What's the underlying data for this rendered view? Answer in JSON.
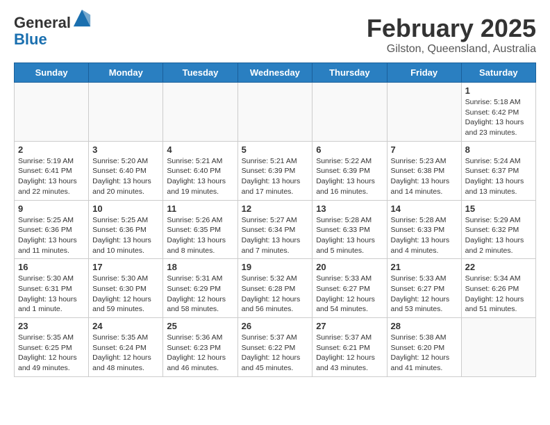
{
  "header": {
    "logo": {
      "general": "General",
      "blue": "Blue"
    },
    "title": "February 2025",
    "subtitle": "Gilston, Queensland, Australia"
  },
  "weekdays": [
    "Sunday",
    "Monday",
    "Tuesday",
    "Wednesday",
    "Thursday",
    "Friday",
    "Saturday"
  ],
  "weeks": [
    [
      {
        "day": "",
        "info": ""
      },
      {
        "day": "",
        "info": ""
      },
      {
        "day": "",
        "info": ""
      },
      {
        "day": "",
        "info": ""
      },
      {
        "day": "",
        "info": ""
      },
      {
        "day": "",
        "info": ""
      },
      {
        "day": "1",
        "info": "Sunrise: 5:18 AM\nSunset: 6:42 PM\nDaylight: 13 hours and 23 minutes."
      }
    ],
    [
      {
        "day": "2",
        "info": "Sunrise: 5:19 AM\nSunset: 6:41 PM\nDaylight: 13 hours and 22 minutes."
      },
      {
        "day": "3",
        "info": "Sunrise: 5:20 AM\nSunset: 6:40 PM\nDaylight: 13 hours and 20 minutes."
      },
      {
        "day": "4",
        "info": "Sunrise: 5:21 AM\nSunset: 6:40 PM\nDaylight: 13 hours and 19 minutes."
      },
      {
        "day": "5",
        "info": "Sunrise: 5:21 AM\nSunset: 6:39 PM\nDaylight: 13 hours and 17 minutes."
      },
      {
        "day": "6",
        "info": "Sunrise: 5:22 AM\nSunset: 6:39 PM\nDaylight: 13 hours and 16 minutes."
      },
      {
        "day": "7",
        "info": "Sunrise: 5:23 AM\nSunset: 6:38 PM\nDaylight: 13 hours and 14 minutes."
      },
      {
        "day": "8",
        "info": "Sunrise: 5:24 AM\nSunset: 6:37 PM\nDaylight: 13 hours and 13 minutes."
      }
    ],
    [
      {
        "day": "9",
        "info": "Sunrise: 5:25 AM\nSunset: 6:36 PM\nDaylight: 13 hours and 11 minutes."
      },
      {
        "day": "10",
        "info": "Sunrise: 5:25 AM\nSunset: 6:36 PM\nDaylight: 13 hours and 10 minutes."
      },
      {
        "day": "11",
        "info": "Sunrise: 5:26 AM\nSunset: 6:35 PM\nDaylight: 13 hours and 8 minutes."
      },
      {
        "day": "12",
        "info": "Sunrise: 5:27 AM\nSunset: 6:34 PM\nDaylight: 13 hours and 7 minutes."
      },
      {
        "day": "13",
        "info": "Sunrise: 5:28 AM\nSunset: 6:33 PM\nDaylight: 13 hours and 5 minutes."
      },
      {
        "day": "14",
        "info": "Sunrise: 5:28 AM\nSunset: 6:33 PM\nDaylight: 13 hours and 4 minutes."
      },
      {
        "day": "15",
        "info": "Sunrise: 5:29 AM\nSunset: 6:32 PM\nDaylight: 13 hours and 2 minutes."
      }
    ],
    [
      {
        "day": "16",
        "info": "Sunrise: 5:30 AM\nSunset: 6:31 PM\nDaylight: 13 hours and 1 minute."
      },
      {
        "day": "17",
        "info": "Sunrise: 5:30 AM\nSunset: 6:30 PM\nDaylight: 12 hours and 59 minutes."
      },
      {
        "day": "18",
        "info": "Sunrise: 5:31 AM\nSunset: 6:29 PM\nDaylight: 12 hours and 58 minutes."
      },
      {
        "day": "19",
        "info": "Sunrise: 5:32 AM\nSunset: 6:28 PM\nDaylight: 12 hours and 56 minutes."
      },
      {
        "day": "20",
        "info": "Sunrise: 5:33 AM\nSunset: 6:27 PM\nDaylight: 12 hours and 54 minutes."
      },
      {
        "day": "21",
        "info": "Sunrise: 5:33 AM\nSunset: 6:27 PM\nDaylight: 12 hours and 53 minutes."
      },
      {
        "day": "22",
        "info": "Sunrise: 5:34 AM\nSunset: 6:26 PM\nDaylight: 12 hours and 51 minutes."
      }
    ],
    [
      {
        "day": "23",
        "info": "Sunrise: 5:35 AM\nSunset: 6:25 PM\nDaylight: 12 hours and 49 minutes."
      },
      {
        "day": "24",
        "info": "Sunrise: 5:35 AM\nSunset: 6:24 PM\nDaylight: 12 hours and 48 minutes."
      },
      {
        "day": "25",
        "info": "Sunrise: 5:36 AM\nSunset: 6:23 PM\nDaylight: 12 hours and 46 minutes."
      },
      {
        "day": "26",
        "info": "Sunrise: 5:37 AM\nSunset: 6:22 PM\nDaylight: 12 hours and 45 minutes."
      },
      {
        "day": "27",
        "info": "Sunrise: 5:37 AM\nSunset: 6:21 PM\nDaylight: 12 hours and 43 minutes."
      },
      {
        "day": "28",
        "info": "Sunrise: 5:38 AM\nSunset: 6:20 PM\nDaylight: 12 hours and 41 minutes."
      },
      {
        "day": "",
        "info": ""
      }
    ]
  ]
}
